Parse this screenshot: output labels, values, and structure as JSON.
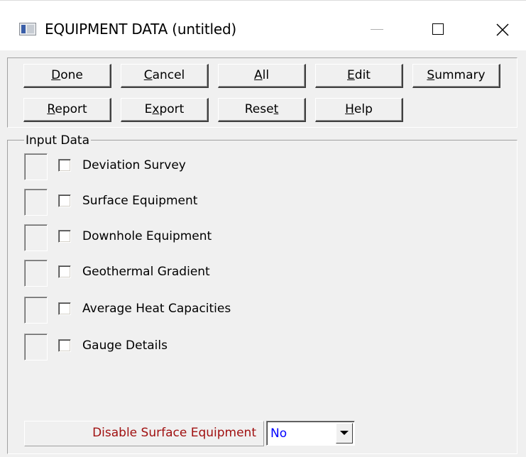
{
  "window": {
    "title": "EQUIPMENT DATA (untitled)"
  },
  "toolbar": {
    "row1": [
      {
        "pre": "",
        "ul": "D",
        "post": "one"
      },
      {
        "pre": "",
        "ul": "C",
        "post": "ancel"
      },
      {
        "pre": "",
        "ul": "A",
        "post": "ll"
      },
      {
        "pre": "",
        "ul": "E",
        "post": "dit"
      },
      {
        "pre": "",
        "ul": "S",
        "post": "ummary"
      }
    ],
    "row2": [
      {
        "pre": "",
        "ul": "R",
        "post": "eport"
      },
      {
        "pre": "E",
        "ul": "x",
        "post": "port"
      },
      {
        "pre": "Rese",
        "ul": "t",
        "post": ""
      },
      {
        "pre": "",
        "ul": "H",
        "post": "elp"
      }
    ]
  },
  "input_data": {
    "group_label": "Input Data",
    "items": [
      {
        "label": "Deviation Survey",
        "checked": false
      },
      {
        "label": "Surface Equipment",
        "checked": false
      },
      {
        "label": "Downhole Equipment",
        "checked": false
      },
      {
        "label": "Geothermal Gradient",
        "checked": false
      },
      {
        "label": "Average Heat Capacities",
        "checked": false
      },
      {
        "label": "Gauge Details",
        "checked": false
      }
    ]
  },
  "disable_surface": {
    "label": "Disable Surface Equipment",
    "value": "No"
  },
  "colors": {
    "window_bg": "#f0f0f0",
    "label_red": "#a01010",
    "value_blue": "#0000ff"
  }
}
